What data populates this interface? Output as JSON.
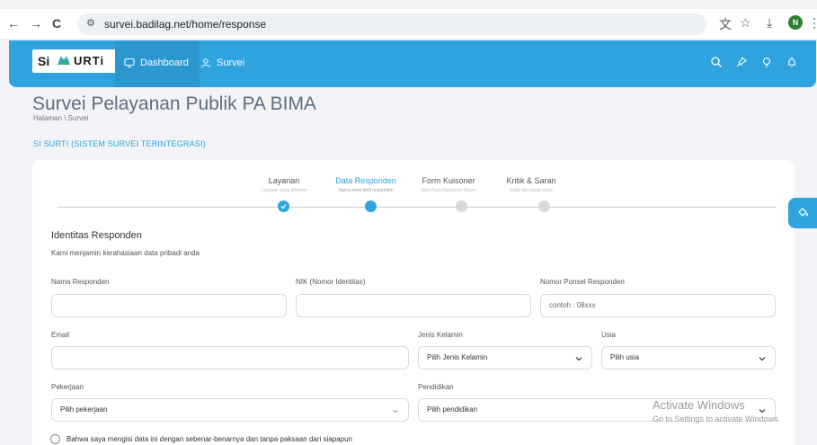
{
  "browser": {
    "url": "survei.badilag.net/home/response",
    "back": "←",
    "forward": "→",
    "reload": "C"
  },
  "header": {
    "logo_si": "Si",
    "logo_urti": "URTi",
    "menu": [
      {
        "label": "Dashboard",
        "icon": "monitor-icon"
      },
      {
        "label": "Survei",
        "icon": "person-icon"
      }
    ],
    "icons": [
      "search-icon",
      "pin-icon",
      "bulb-icon",
      "bell-icon"
    ],
    "accent": "#2ea3dd"
  },
  "page": {
    "title": "Survei Pelayanan Publik PA BIMA",
    "breadcrumb": "Halaman \\ Survei",
    "section": "SI SURTI (SISTEM SURVEI TERINTEGRASI)"
  },
  "stepper": [
    {
      "title": "Layanan",
      "sub": "Layanan yang diterima",
      "state": "done"
    },
    {
      "title": "Data Responden",
      "sub": "Nama serta detil responden",
      "state": "active"
    },
    {
      "title": "Form Kuisoner",
      "sub": "Isian Form Kuisioner Survei",
      "state": "pending"
    },
    {
      "title": "Kritik & Saran",
      "sub": "Kritik dan saran anda",
      "state": "pending"
    }
  ],
  "form": {
    "title": "Identitas Responden",
    "subtitle": "Kami menjamin kerahasiaan data pribadi anda",
    "nama_label": "Nama Responden",
    "nik_label": "NIK (Nomor Identitas)",
    "phone_label": "Nomor Ponsel Responden",
    "phone_placeholder": "contoh : 08xxx",
    "email_label": "Email",
    "gender_label": "Jenis Kelamin",
    "gender_value": "Pilih Jenis Kelamin",
    "age_label": "Usia",
    "age_value": "Pilih usia",
    "job_label": "Pekerjaan",
    "job_value": "Pilih pekerjaan",
    "edu_label": "Pendidikan",
    "edu_value": "Pilih pendidikan",
    "agreement": "Bahwa saya mengisi data ini dengan sebenar-benarnya dan tanpa paksaan dari siapapun"
  },
  "watermark": {
    "line1": "Activate Windows",
    "line2": "Go to Settings to activate Windows."
  }
}
